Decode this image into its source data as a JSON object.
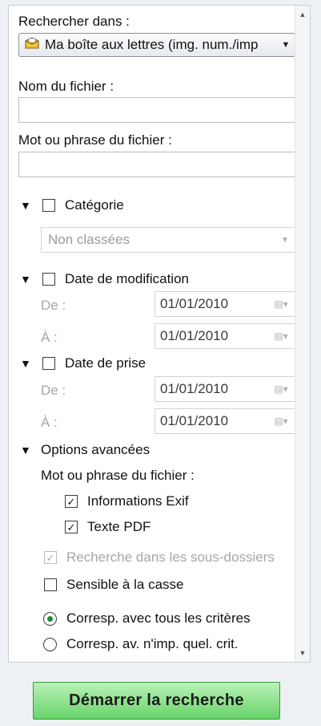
{
  "search_in": {
    "label": "Rechercher dans :",
    "value": "Ma boîte aux lettres (img. num./imp",
    "icon": "mailbox-icon"
  },
  "file_name": {
    "label": "Nom du fichier :",
    "value": ""
  },
  "file_phrase": {
    "label": "Mot ou phrase du fichier :",
    "value": ""
  },
  "category": {
    "label": "Catégorie",
    "checked": false,
    "value": "Non classées"
  },
  "modified_date": {
    "label": "Date de modification",
    "checked": false,
    "from_label": "De :",
    "from_value": "01/01/2010",
    "to_label": "À :",
    "to_value": "01/01/2010"
  },
  "shot_date": {
    "label": "Date de prise",
    "checked": false,
    "from_label": "De :",
    "from_value": "01/01/2010",
    "to_label": "À :",
    "to_value": "01/01/2010"
  },
  "advanced": {
    "label": "Options avancées",
    "phrase_label": "Mot ou phrase du fichier :",
    "exif_label": "Informations Exif",
    "exif_checked": true,
    "pdf_label": "Texte PDF",
    "pdf_checked": true,
    "subfolders_label": "Recherche dans les sous-dossiers",
    "subfolders_checked": true,
    "case_label": "Sensible à la casse",
    "case_checked": false,
    "match_all_label": "Corresp. avec tous les critères",
    "match_any_label": "Corresp. av. n'imp. quel. crit.",
    "selected_match": "all"
  },
  "start_button": {
    "label": "Démarrer la recherche"
  },
  "colors": {
    "button_top": "#b9f2b6",
    "button_bottom": "#67d36a",
    "radio_selected": "#1f8f32"
  }
}
